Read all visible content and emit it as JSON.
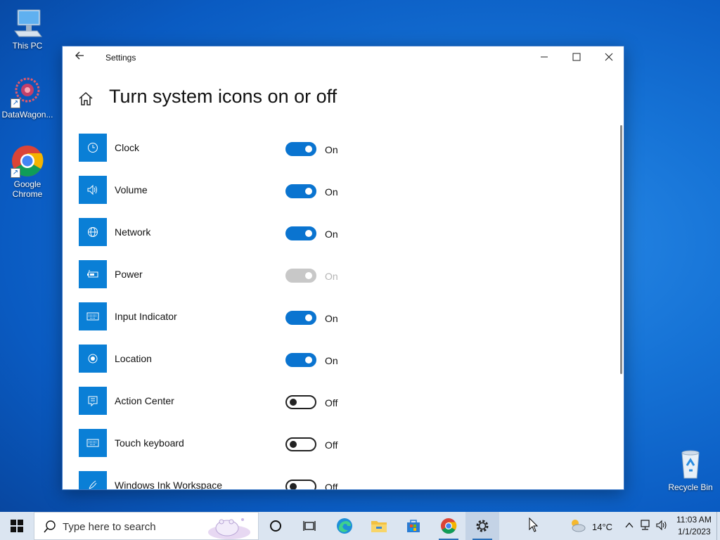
{
  "desktop": {
    "icons": [
      {
        "label": "This PC"
      },
      {
        "label": "DataWagon..."
      },
      {
        "label": "Google Chrome"
      },
      {
        "label": "Recycle Bin"
      }
    ]
  },
  "window": {
    "title": "Settings",
    "page_title": "Turn system icons on or off",
    "accent": "#0a74d0"
  },
  "items": [
    {
      "label": "Clock",
      "state": "On",
      "icon": "clock-icon"
    },
    {
      "label": "Volume",
      "state": "On",
      "icon": "volume-icon"
    },
    {
      "label": "Network",
      "state": "On",
      "icon": "network-globe-icon"
    },
    {
      "label": "Power",
      "state": "On",
      "icon": "battery-icon",
      "disabled": true
    },
    {
      "label": "Input Indicator",
      "state": "On",
      "icon": "keyboard-icon"
    },
    {
      "label": "Location",
      "state": "On",
      "icon": "location-icon"
    },
    {
      "label": "Action Center",
      "state": "Off",
      "icon": "action-center-icon"
    },
    {
      "label": "Touch keyboard",
      "state": "Off",
      "icon": "touch-keyboard-icon"
    },
    {
      "label": "Windows Ink Workspace",
      "state": "Off",
      "icon": "pen-icon"
    }
  ],
  "taskbar": {
    "search_placeholder": "Type here to search",
    "weather": "14°C",
    "time": "11:03 AM",
    "date": "1/1/2023"
  }
}
